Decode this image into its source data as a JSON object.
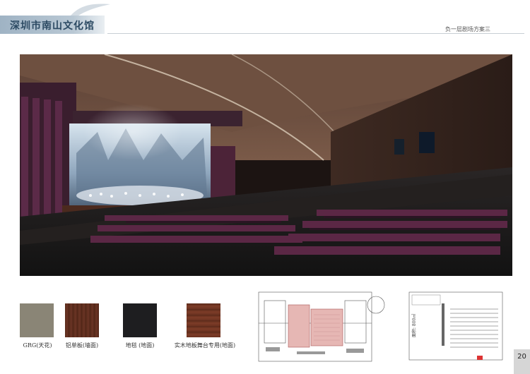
{
  "header": {
    "title": "深圳市南山文化馆",
    "subtitle": "负一层剧场方案三"
  },
  "materials": [
    {
      "label": "GRG(天花)",
      "color": "#8a8576"
    },
    {
      "label": "铝单板(墙面)",
      "color": "#5a2c1c"
    },
    {
      "label": "地毯 (地面)",
      "color": "#1e1e20"
    },
    {
      "label": "实木地板舞台专用(地面)",
      "color": "#6b3220"
    }
  ],
  "plan_right": {
    "area_text": "面积: 800㎡"
  },
  "page_number": "20"
}
